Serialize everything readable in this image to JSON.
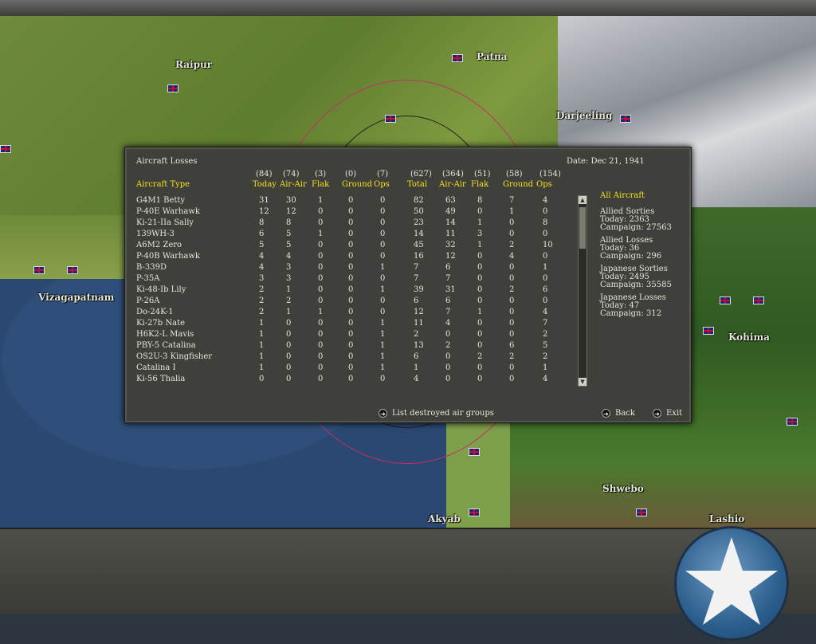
{
  "window": {
    "title": ""
  },
  "map": {
    "cities": [
      {
        "id": "raipur",
        "name": "Raipur"
      },
      {
        "id": "patna",
        "name": "Patna"
      },
      {
        "id": "darjeeling",
        "name": "Darjeeling"
      },
      {
        "id": "vizagapatnam",
        "name": "Vizagapatnam"
      },
      {
        "id": "kohima",
        "name": "Kohima"
      },
      {
        "id": "shwebo",
        "name": "Shwebo"
      },
      {
        "id": "akyab",
        "name": "Akyab"
      },
      {
        "id": "lashio",
        "name": "Lashio"
      }
    ]
  },
  "panel": {
    "title": "Aircraft Losses",
    "date": "Date: Dec 21, 1941",
    "type_header": "Aircraft Type",
    "col_totals": [
      "(84)",
      "(74)",
      "(3)",
      "(0)",
      "(7)",
      "(627)",
      "(364)",
      "(51)",
      "(58)",
      "(154)"
    ],
    "col_labels": [
      "Today",
      "Air-Air",
      "Flak",
      "Ground",
      "Ops",
      "Total",
      "Air-Air",
      "Flak",
      "Ground",
      "Ops"
    ],
    "rows": [
      {
        "name": "G4M1 Betty",
        "v": [
          "31",
          "30",
          "1",
          "0",
          "0",
          "82",
          "63",
          "8",
          "7",
          "4"
        ]
      },
      {
        "name": "P-40E Warhawk",
        "v": [
          "12",
          "12",
          "0",
          "0",
          "0",
          "50",
          "49",
          "0",
          "1",
          "0"
        ]
      },
      {
        "name": "Ki-21-IIa Sally",
        "v": [
          "8",
          "8",
          "0",
          "0",
          "0",
          "23",
          "14",
          "1",
          "0",
          "8"
        ]
      },
      {
        "name": "139WH-3",
        "v": [
          "6",
          "5",
          "1",
          "0",
          "0",
          "14",
          "11",
          "3",
          "0",
          "0"
        ]
      },
      {
        "name": "A6M2 Zero",
        "v": [
          "5",
          "5",
          "0",
          "0",
          "0",
          "45",
          "32",
          "1",
          "2",
          "10"
        ]
      },
      {
        "name": "P-40B Warhawk",
        "v": [
          "4",
          "4",
          "0",
          "0",
          "0",
          "16",
          "12",
          "0",
          "4",
          "0"
        ]
      },
      {
        "name": "B-339D",
        "v": [
          "4",
          "3",
          "0",
          "0",
          "1",
          "7",
          "6",
          "0",
          "0",
          "1"
        ]
      },
      {
        "name": "P-35A",
        "v": [
          "3",
          "3",
          "0",
          "0",
          "0",
          "7",
          "7",
          "0",
          "0",
          "0"
        ]
      },
      {
        "name": "Ki-48-Ib Lily",
        "v": [
          "2",
          "1",
          "0",
          "0",
          "1",
          "39",
          "31",
          "0",
          "2",
          "6"
        ]
      },
      {
        "name": "P-26A",
        "v": [
          "2",
          "2",
          "0",
          "0",
          "0",
          "6",
          "6",
          "0",
          "0",
          "0"
        ]
      },
      {
        "name": "Do-24K-1",
        "v": [
          "2",
          "1",
          "1",
          "0",
          "0",
          "12",
          "7",
          "1",
          "0",
          "4"
        ]
      },
      {
        "name": "Ki-27b Nate",
        "v": [
          "1",
          "0",
          "0",
          "0",
          "1",
          "11",
          "4",
          "0",
          "0",
          "7"
        ]
      },
      {
        "name": "H6K2-L Mavis",
        "v": [
          "1",
          "0",
          "0",
          "0",
          "1",
          "2",
          "0",
          "0",
          "0",
          "2"
        ]
      },
      {
        "name": "PBY-5 Catalina",
        "v": [
          "1",
          "0",
          "0",
          "0",
          "1",
          "13",
          "2",
          "0",
          "6",
          "5"
        ]
      },
      {
        "name": "OS2U-3 Kingfisher",
        "v": [
          "1",
          "0",
          "0",
          "0",
          "1",
          "6",
          "0",
          "2",
          "2",
          "2"
        ]
      },
      {
        "name": "Catalina I",
        "v": [
          "1",
          "0",
          "0",
          "0",
          "1",
          "1",
          "0",
          "0",
          "0",
          "1"
        ]
      },
      {
        "name": "Ki-56 Thalia",
        "v": [
          "0",
          "0",
          "0",
          "0",
          "0",
          "4",
          "0",
          "0",
          "0",
          "4"
        ]
      }
    ],
    "side": {
      "heading": "All Aircraft",
      "blocks": [
        {
          "title": "Allied Sorties",
          "today": "Today:   2363",
          "campaign": "Campaign: 27563"
        },
        {
          "title": "Allied Losses",
          "today": "Today:   36",
          "campaign": "Campaign: 296"
        },
        {
          "title": "Japanese Sorties",
          "today": "Today:   2495",
          "campaign": "Campaign: 35585"
        },
        {
          "title": "Japanese Losses",
          "today": "Today:   47",
          "campaign": "Campaign: 312"
        }
      ]
    },
    "buttons": {
      "list_destroyed": "List destroyed air groups",
      "back": "Back",
      "exit": "Exit"
    }
  },
  "colors": {
    "accent_yellow": "#f2e21a",
    "panel_bg": "#3f3f3b",
    "sea": "#2b4872"
  }
}
